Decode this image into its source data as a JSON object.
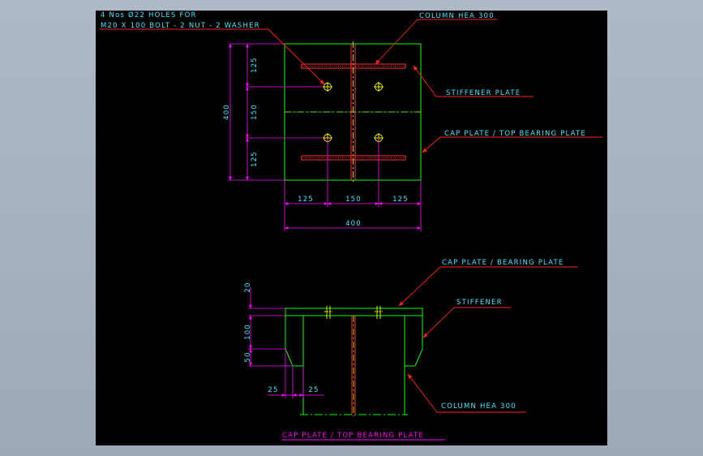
{
  "colors": {
    "background": "#000000",
    "viewport": "#aab5c3",
    "outline": "#00ff00",
    "dimension": "#ff00ff",
    "text": "#40e8ff",
    "leader": "#ff2020",
    "centerline": "#ffff00",
    "hole": "#ffff00",
    "title": "#ff00ff"
  },
  "plan_view": {
    "holes_note_line1": "4 Nos Ø22 HOLES FOR",
    "holes_note_line2": "M20 X 100 BOLT - 2 NUT - 2 WASHER",
    "column_label": "COLUMN HEA 300",
    "stiffener_label": "STIFFENER PLATE",
    "cap_plate_label": "CAP PLATE / TOP BEARING PLATE",
    "dims": {
      "overall_height": "400",
      "v_top": "125",
      "v_mid": "150",
      "v_bottom": "125",
      "h_left": "125",
      "h_mid": "150",
      "h_right": "125",
      "overall_width": "400"
    }
  },
  "elevation_view": {
    "cap_plate_label": "CAP PLATE / BEARING PLATE",
    "stiffener_label": "STIFFENER",
    "column_label": "COLUMN HEA 300",
    "dims": {
      "plate_thickness": "20",
      "stiffener_height": "100",
      "chamfer": "50",
      "offset_left": "25",
      "offset_right": "25"
    }
  },
  "drawing_title": "CAP PLATE / TOP BEARING PLATE"
}
